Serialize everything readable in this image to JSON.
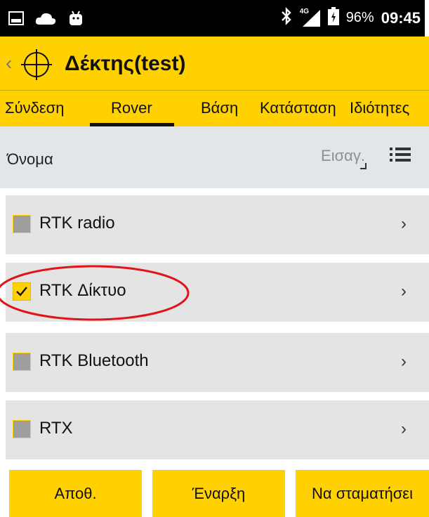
{
  "status_bar": {
    "battery": "96%",
    "time": "09:45",
    "network": "4G",
    "icons": [
      "gallery-icon",
      "cloud-icon",
      "android-icon",
      "bluetooth-icon",
      "signal-icon",
      "battery-icon"
    ]
  },
  "app_bar": {
    "title": "Δέκτης(test)",
    "icons": [
      "back-chevron-icon",
      "target-icon"
    ]
  },
  "tabs": [
    {
      "label": "Σύνδεση",
      "active": false
    },
    {
      "label": "Rover",
      "active": true
    },
    {
      "label": "Βάση",
      "active": false
    },
    {
      "label": "Κατάσταση",
      "active": false
    },
    {
      "label": "Ιδιότητες",
      "active": false
    }
  ],
  "name_row": {
    "label": "Όνομα",
    "input_placeholder": "Εισαγ.",
    "input_value": ""
  },
  "items": [
    {
      "label": "RTK radio",
      "checked": false
    },
    {
      "label": "RTK Δίκτυο",
      "checked": true
    },
    {
      "label": "RTK Bluetooth",
      "checked": false
    },
    {
      "label": "RTX",
      "checked": false
    }
  ],
  "buttons": {
    "save": "Αποθ.",
    "start": "Έναρξη",
    "stop": "Να σταματήσει"
  },
  "colors": {
    "accent": "#FFD100",
    "status_bar": "#000000",
    "row_background": "#E4E4E4",
    "header_background": "#E3E6E8",
    "annotation": "#E0141B"
  }
}
